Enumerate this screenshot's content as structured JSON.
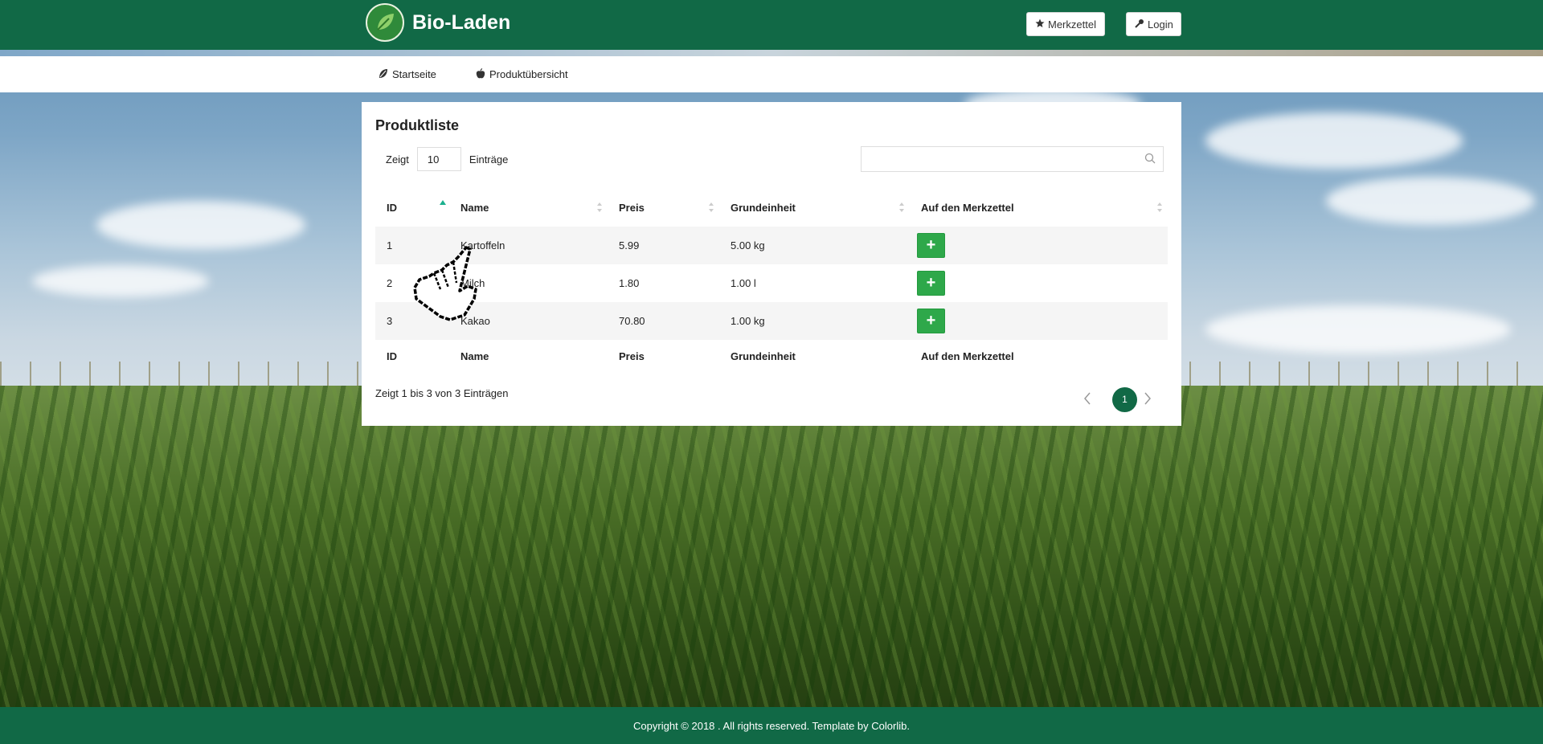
{
  "brand": {
    "title": "Bio-Laden"
  },
  "header": {
    "merkzettel_label": "Merkzettel",
    "login_label": "Login"
  },
  "nav": {
    "items": [
      {
        "label": "Startseite"
      },
      {
        "label": "Produktübersicht"
      }
    ]
  },
  "card": {
    "title": "Produktliste",
    "length": {
      "prefix": "Zeigt",
      "value": "10",
      "suffix": "Einträge"
    },
    "search": {
      "placeholder": "",
      "value": ""
    },
    "table": {
      "columns": [
        "ID",
        "Name",
        "Preis",
        "Grundeinheit",
        "Auf den Merkzettel"
      ],
      "rows": [
        {
          "id": "1",
          "name": "Kartoffeln",
          "price": "5.99",
          "unit": "5.00 kg",
          "action": "+"
        },
        {
          "id": "2",
          "name": "Milch",
          "price": "1.80",
          "unit": "1.00 l",
          "action": "+"
        },
        {
          "id": "3",
          "name": "Kakao",
          "price": "70.80",
          "unit": "1.00 kg",
          "action": "+"
        }
      ]
    },
    "info": "Zeigt 1 bis 3 von 3 Einträgen",
    "pagination": {
      "current": "1"
    }
  },
  "footer": {
    "text": "Copyright © 2018 . All rights reserved. Template by Colorlib."
  },
  "colors": {
    "primary": "#116946",
    "add_button": "#2ea84a",
    "sort_active": "#1bb08e"
  },
  "icons": {
    "merkzettel": "star-icon",
    "login": "key-icon",
    "startseite": "leaf-icon",
    "produkt": "apple-icon",
    "search": "search-icon"
  }
}
